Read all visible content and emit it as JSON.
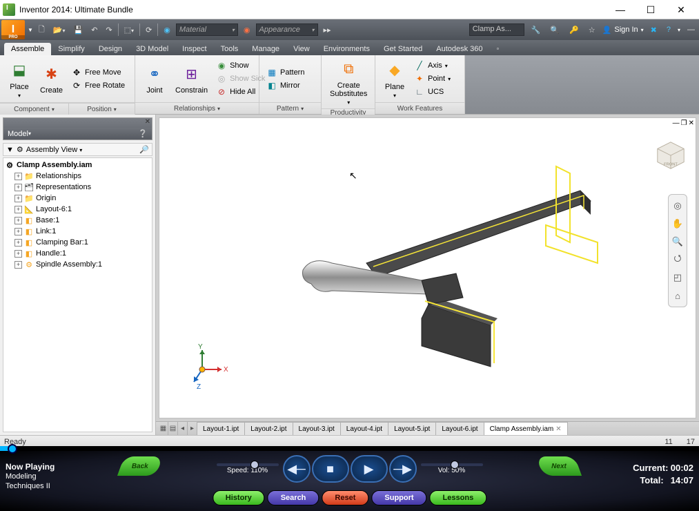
{
  "window": {
    "title": "Inventor 2014: Ultimate Bundle"
  },
  "qat": {
    "material_placeholder": "Material",
    "appearance_placeholder": "Appearance",
    "search": "Clamp As...",
    "signin": "Sign In"
  },
  "ribbon_tabs": [
    "Assemble",
    "Simplify",
    "Design",
    "3D Model",
    "Inspect",
    "Tools",
    "Manage",
    "View",
    "Environments",
    "Get Started",
    "Autodesk 360"
  ],
  "ribbon_active_tab": "Assemble",
  "ribbon": {
    "component": {
      "label": "Component",
      "place": "Place",
      "create": "Create",
      "free_move": "Free Move",
      "free_rotate": "Free Rotate"
    },
    "position": {
      "label": "Position"
    },
    "relationships": {
      "label": "Relationships",
      "joint": "Joint",
      "constrain": "Constrain",
      "show": "Show",
      "show_sick": "Show Sick",
      "hide_all": "Hide All"
    },
    "pattern": {
      "label": "Pattern",
      "pattern": "Pattern",
      "mirror": "Mirror"
    },
    "productivity": {
      "label": "Productivity",
      "create_subs": "Create Substitutes"
    },
    "work": {
      "label": "Work Features",
      "plane": "Plane",
      "axis": "Axis",
      "point": "Point",
      "ucs": "UCS"
    }
  },
  "browser": {
    "panel_label": "Model",
    "view_mode": "Assembly View",
    "root": "Clamp Assembly.iam",
    "nodes": [
      {
        "label": "Relationships",
        "icon": "folder"
      },
      {
        "label": "Representations",
        "icon": "reps"
      },
      {
        "label": "Origin",
        "icon": "folder"
      },
      {
        "label": "Layout-6:1",
        "icon": "layout"
      },
      {
        "label": "Base:1",
        "icon": "part"
      },
      {
        "label": "Link:1",
        "icon": "part"
      },
      {
        "label": "Clamping Bar:1",
        "icon": "part"
      },
      {
        "label": "Handle:1",
        "icon": "part"
      },
      {
        "label": "Spindle Assembly:1",
        "icon": "asm"
      }
    ]
  },
  "triad": {
    "x": "X",
    "y": "Y",
    "z": "Z"
  },
  "doc_tabs": [
    "Layout-1.ipt",
    "Layout-2.ipt",
    "Layout-3.ipt",
    "Layout-4.ipt",
    "Layout-5.ipt",
    "Layout-6.ipt",
    "Clamp Assembly.iam"
  ],
  "doc_active_tab": "Clamp Assembly.iam",
  "status": {
    "left": "Ready",
    "num1": "11",
    "num2": "17"
  },
  "player": {
    "now_heading": "Now Playing",
    "now_line1": "Modeling",
    "now_line2": "Techniques II",
    "back": "Back",
    "next": "Next",
    "speed_label": "Speed: 110%",
    "vol_label": "Vol: 50%",
    "history": "History",
    "search": "Search",
    "reset": "Reset",
    "support": "Support",
    "lessons": "Lessons",
    "current_label": "Current:",
    "current_val": "00:02",
    "total_label": "Total:",
    "total_val": "14:07"
  }
}
